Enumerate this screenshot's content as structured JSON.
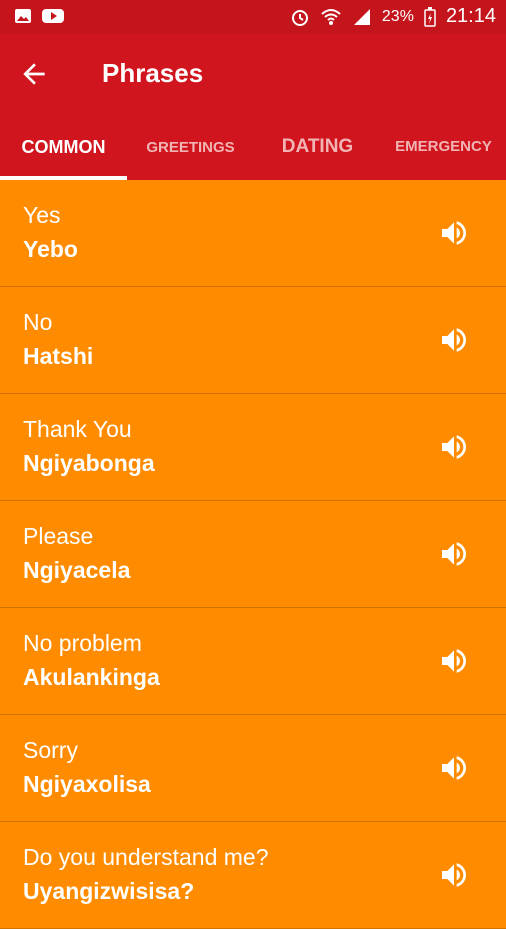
{
  "status": {
    "battery": "23%",
    "time": "21:14"
  },
  "appbar": {
    "title": "Phrases"
  },
  "tabs": [
    "COMMON",
    "GREETINGS",
    "DATING",
    "EMERGENCY"
  ],
  "phrases": [
    {
      "english": "Yes",
      "zulu": "Yebo"
    },
    {
      "english": "No",
      "zulu": "Hatshi"
    },
    {
      "english": "Thank You",
      "zulu": "Ngiyabonga"
    },
    {
      "english": "Please",
      "zulu": "Ngiyacela"
    },
    {
      "english": "No problem",
      "zulu": "Akulankinga"
    },
    {
      "english": "Sorry",
      "zulu": "Ngiyaxolisa"
    },
    {
      "english": "Do you understand me?",
      "zulu": "Uyangizwisisa?"
    }
  ],
  "colors": {
    "primary": "#D1151E",
    "status_bar": "#C4151C",
    "list_bg": "#FF8C00"
  }
}
